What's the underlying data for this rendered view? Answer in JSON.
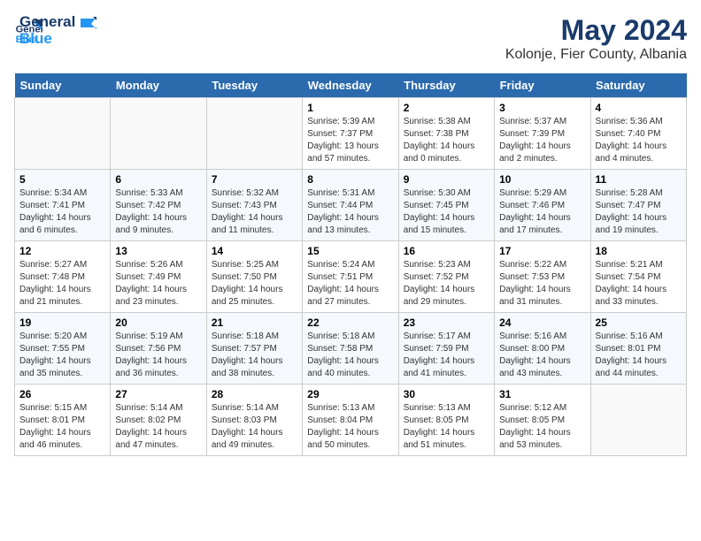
{
  "header": {
    "logo_line1": "General",
    "logo_line2": "Blue",
    "month_year": "May 2024",
    "location": "Kolonje, Fier County, Albania"
  },
  "days_of_week": [
    "Sunday",
    "Monday",
    "Tuesday",
    "Wednesday",
    "Thursday",
    "Friday",
    "Saturday"
  ],
  "weeks": [
    [
      {
        "day": "",
        "text": ""
      },
      {
        "day": "",
        "text": ""
      },
      {
        "day": "",
        "text": ""
      },
      {
        "day": "1",
        "text": "Sunrise: 5:39 AM\nSunset: 7:37 PM\nDaylight: 13 hours and 57 minutes."
      },
      {
        "day": "2",
        "text": "Sunrise: 5:38 AM\nSunset: 7:38 PM\nDaylight: 14 hours and 0 minutes."
      },
      {
        "day": "3",
        "text": "Sunrise: 5:37 AM\nSunset: 7:39 PM\nDaylight: 14 hours and 2 minutes."
      },
      {
        "day": "4",
        "text": "Sunrise: 5:36 AM\nSunset: 7:40 PM\nDaylight: 14 hours and 4 minutes."
      }
    ],
    [
      {
        "day": "5",
        "text": "Sunrise: 5:34 AM\nSunset: 7:41 PM\nDaylight: 14 hours and 6 minutes."
      },
      {
        "day": "6",
        "text": "Sunrise: 5:33 AM\nSunset: 7:42 PM\nDaylight: 14 hours and 9 minutes."
      },
      {
        "day": "7",
        "text": "Sunrise: 5:32 AM\nSunset: 7:43 PM\nDaylight: 14 hours and 11 minutes."
      },
      {
        "day": "8",
        "text": "Sunrise: 5:31 AM\nSunset: 7:44 PM\nDaylight: 14 hours and 13 minutes."
      },
      {
        "day": "9",
        "text": "Sunrise: 5:30 AM\nSunset: 7:45 PM\nDaylight: 14 hours and 15 minutes."
      },
      {
        "day": "10",
        "text": "Sunrise: 5:29 AM\nSunset: 7:46 PM\nDaylight: 14 hours and 17 minutes."
      },
      {
        "day": "11",
        "text": "Sunrise: 5:28 AM\nSunset: 7:47 PM\nDaylight: 14 hours and 19 minutes."
      }
    ],
    [
      {
        "day": "12",
        "text": "Sunrise: 5:27 AM\nSunset: 7:48 PM\nDaylight: 14 hours and 21 minutes."
      },
      {
        "day": "13",
        "text": "Sunrise: 5:26 AM\nSunset: 7:49 PM\nDaylight: 14 hours and 23 minutes."
      },
      {
        "day": "14",
        "text": "Sunrise: 5:25 AM\nSunset: 7:50 PM\nDaylight: 14 hours and 25 minutes."
      },
      {
        "day": "15",
        "text": "Sunrise: 5:24 AM\nSunset: 7:51 PM\nDaylight: 14 hours and 27 minutes."
      },
      {
        "day": "16",
        "text": "Sunrise: 5:23 AM\nSunset: 7:52 PM\nDaylight: 14 hours and 29 minutes."
      },
      {
        "day": "17",
        "text": "Sunrise: 5:22 AM\nSunset: 7:53 PM\nDaylight: 14 hours and 31 minutes."
      },
      {
        "day": "18",
        "text": "Sunrise: 5:21 AM\nSunset: 7:54 PM\nDaylight: 14 hours and 33 minutes."
      }
    ],
    [
      {
        "day": "19",
        "text": "Sunrise: 5:20 AM\nSunset: 7:55 PM\nDaylight: 14 hours and 35 minutes."
      },
      {
        "day": "20",
        "text": "Sunrise: 5:19 AM\nSunset: 7:56 PM\nDaylight: 14 hours and 36 minutes."
      },
      {
        "day": "21",
        "text": "Sunrise: 5:18 AM\nSunset: 7:57 PM\nDaylight: 14 hours and 38 minutes."
      },
      {
        "day": "22",
        "text": "Sunrise: 5:18 AM\nSunset: 7:58 PM\nDaylight: 14 hours and 40 minutes."
      },
      {
        "day": "23",
        "text": "Sunrise: 5:17 AM\nSunset: 7:59 PM\nDaylight: 14 hours and 41 minutes."
      },
      {
        "day": "24",
        "text": "Sunrise: 5:16 AM\nSunset: 8:00 PM\nDaylight: 14 hours and 43 minutes."
      },
      {
        "day": "25",
        "text": "Sunrise: 5:16 AM\nSunset: 8:01 PM\nDaylight: 14 hours and 44 minutes."
      }
    ],
    [
      {
        "day": "26",
        "text": "Sunrise: 5:15 AM\nSunset: 8:01 PM\nDaylight: 14 hours and 46 minutes."
      },
      {
        "day": "27",
        "text": "Sunrise: 5:14 AM\nSunset: 8:02 PM\nDaylight: 14 hours and 47 minutes."
      },
      {
        "day": "28",
        "text": "Sunrise: 5:14 AM\nSunset: 8:03 PM\nDaylight: 14 hours and 49 minutes."
      },
      {
        "day": "29",
        "text": "Sunrise: 5:13 AM\nSunset: 8:04 PM\nDaylight: 14 hours and 50 minutes."
      },
      {
        "day": "30",
        "text": "Sunrise: 5:13 AM\nSunset: 8:05 PM\nDaylight: 14 hours and 51 minutes."
      },
      {
        "day": "31",
        "text": "Sunrise: 5:12 AM\nSunset: 8:05 PM\nDaylight: 14 hours and 53 minutes."
      },
      {
        "day": "",
        "text": ""
      }
    ]
  ]
}
